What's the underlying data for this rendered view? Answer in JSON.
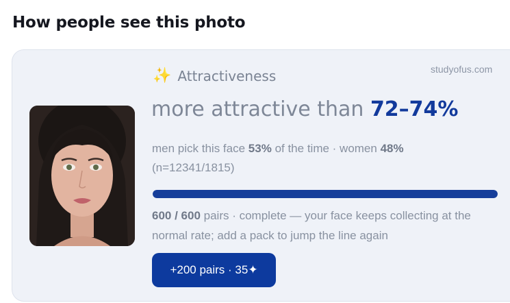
{
  "section": {
    "title": "How people see this photo"
  },
  "card": {
    "watermark": "studyofus.com",
    "kicker": {
      "icon": "sparkles-icon",
      "label": "Attractiveness"
    },
    "headline": {
      "prefix": "more attractive than",
      "range": "72–74%"
    },
    "stats": {
      "men_prefix": "men pick this face",
      "men_value": "53%",
      "men_suffix": "of the time · women",
      "women_value": "48%",
      "sample": "(n=12341/1815)"
    },
    "progress": {
      "fraction": 1.0,
      "color": "#163e9a"
    },
    "pairs": {
      "count": "600 / 600",
      "text": "pairs · complete — your face keeps collecting at the normal rate; add a pack to jump the line again"
    },
    "button": {
      "label": "+200 pairs · 35✦"
    }
  },
  "colors": {
    "accent": "#123a9c",
    "button": "#0d3a9e",
    "card_bg": "#eff2f8"
  }
}
